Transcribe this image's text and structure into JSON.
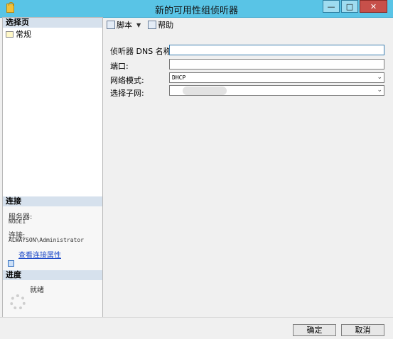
{
  "window": {
    "title": "新的可用性组侦听器",
    "minimize_glyph": "—",
    "maximize_glyph": "□",
    "close_glyph": "✕"
  },
  "left": {
    "select_page_header": "选择页",
    "pages": [
      {
        "label": "常规"
      }
    ],
    "connection_header": "连接",
    "server_label": "服务器:",
    "server_value": "NODE1",
    "connection_label": "连接:",
    "connection_value": "ALWAYSON\\Administrator",
    "view_connection_link": "查看连接属性",
    "progress_header": "进度",
    "progress_status": "就绪"
  },
  "toolbar": {
    "script_label": "脚本",
    "help_label": "帮助"
  },
  "form": {
    "dns_label": "侦听器 DNS 名称:",
    "dns_value": "",
    "port_label": "端口:",
    "port_value": "",
    "network_mode_label": "网络模式:",
    "network_mode_value": "DHCP",
    "subnet_label": "选择子网:",
    "subnet_value": ""
  },
  "footer": {
    "ok_label": "确定",
    "cancel_label": "取消"
  }
}
